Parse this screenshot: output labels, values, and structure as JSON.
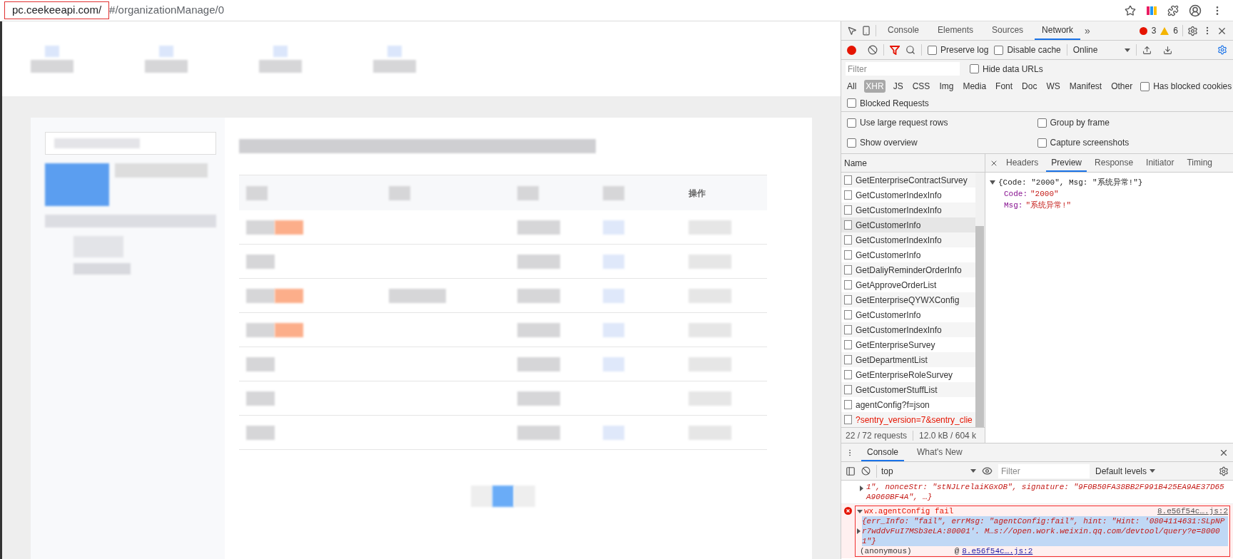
{
  "address_bar": {
    "host": "pc.ceekeeapi.com/",
    "path": "#/organizationManage/0"
  },
  "page": {
    "table": {
      "action_column": "操作"
    }
  },
  "devtools": {
    "tabs": [
      {
        "label": "Console",
        "selected": false
      },
      {
        "label": "Elements",
        "selected": false
      },
      {
        "label": "Sources",
        "selected": false
      },
      {
        "label": "Network",
        "selected": true
      }
    ],
    "more_tabs": "»",
    "errors": "3",
    "warnings": "6",
    "toolbar": {
      "recording": true,
      "options": [
        {
          "label": "Preserve log",
          "checked": false
        },
        {
          "label": "Disable cache",
          "checked": false
        }
      ],
      "throttling": "Online"
    },
    "filter": {
      "placeholder": "Filter",
      "hide_data_urls": {
        "label": "Hide data URLs",
        "checked": false
      }
    },
    "types": [
      {
        "label": "All",
        "selected": false
      },
      {
        "label": "XHR",
        "selected": true
      },
      {
        "label": "JS",
        "selected": false
      },
      {
        "label": "CSS",
        "selected": false
      },
      {
        "label": "Img",
        "selected": false
      },
      {
        "label": "Media",
        "selected": false
      },
      {
        "label": "Font",
        "selected": false
      },
      {
        "label": "Doc",
        "selected": false
      },
      {
        "label": "WS",
        "selected": false
      },
      {
        "label": "Manifest",
        "selected": false
      },
      {
        "label": "Other",
        "selected": false
      }
    ],
    "has_blocked_cookies": {
      "label": "Has blocked cookies",
      "checked": false
    },
    "blocked_requests": {
      "label": "Blocked Requests",
      "checked": false
    },
    "settings": [
      {
        "label": "Use large request rows",
        "checked": false
      },
      {
        "label": "Group by frame",
        "checked": false
      },
      {
        "label": "Show overview",
        "checked": false
      },
      {
        "label": "Capture screenshots",
        "checked": false
      }
    ],
    "name_header": "Name",
    "requests": [
      {
        "name": "GetEnterpriseContractSurvey",
        "selected": false,
        "failed": false
      },
      {
        "name": "GetCustomerIndexInfo",
        "selected": false,
        "failed": false
      },
      {
        "name": "GetCustomerIndexInfo",
        "selected": false,
        "failed": false
      },
      {
        "name": "GetCustomerInfo",
        "selected": true,
        "failed": false
      },
      {
        "name": "GetCustomerIndexInfo",
        "selected": false,
        "failed": false
      },
      {
        "name": "GetCustomerInfo",
        "selected": false,
        "failed": false
      },
      {
        "name": "GetDaliyReminderOrderInfo",
        "selected": false,
        "failed": false
      },
      {
        "name": "GetApproveOrderList",
        "selected": false,
        "failed": false
      },
      {
        "name": "GetEnterpriseQYWXConfig",
        "selected": false,
        "failed": false
      },
      {
        "name": "GetCustomerInfo",
        "selected": false,
        "failed": false
      },
      {
        "name": "GetCustomerIndexInfo",
        "selected": false,
        "failed": false
      },
      {
        "name": "GetEnterpriseSurvey",
        "selected": false,
        "failed": false
      },
      {
        "name": "GetDepartmentList",
        "selected": false,
        "failed": false
      },
      {
        "name": "GetEnterpriseRoleSurvey",
        "selected": false,
        "failed": false
      },
      {
        "name": "GetCustomerStuffList",
        "selected": false,
        "failed": false
      },
      {
        "name": "agentConfig?f=json",
        "selected": false,
        "failed": false
      },
      {
        "name": "?sentry_version=7&sentry_clie",
        "selected": false,
        "failed": true
      }
    ],
    "status_requests": "22 / 72 requests",
    "status_size": "12.0 kB / 604 k",
    "detail_tabs": [
      {
        "label": "Headers",
        "selected": false
      },
      {
        "label": "Preview",
        "selected": true
      },
      {
        "label": "Response",
        "selected": false
      },
      {
        "label": "Initiator",
        "selected": false
      },
      {
        "label": "Timing",
        "selected": false
      }
    ],
    "preview": {
      "summary": "{Code: \"2000\", Msg: \"系统异常!\"}",
      "properties": [
        {
          "key": "Code:",
          "value": "\"2000\""
        },
        {
          "key": "Msg:",
          "value": "\"系统异常!\""
        }
      ]
    },
    "drawer": {
      "tabs": [
        {
          "label": "Console",
          "selected": true
        },
        {
          "label": "What's New",
          "selected": false
        }
      ],
      "context": "top",
      "filter_placeholder": "Filter",
      "levels": "Default levels",
      "messages": [
        {
          "kind": "continuation",
          "text": "1\", nonceStr: \"stNJLrelaiKGxOB\", signature: \"9F0B50FA38BB2F991B425EA9AE37D65A9060BF4A\", …}"
        },
        {
          "kind": "error",
          "title": "wx.agentConfig fail",
          "source": "8.e56f54c….js:2",
          "object": "{err_Info: \"fail\", errMsg: \"agentConfig:fail\", hint: \"Hint: '0804114631:SLpNPr7wddvFuI7MSb3eLA:80001'. M…s://open.work.weixin.qq.com/devtool/query?e=80001\"}",
          "frame": "(anonymous)",
          "at": "@",
          "frame_source": "8.e56f54c….js:2"
        }
      ]
    }
  }
}
